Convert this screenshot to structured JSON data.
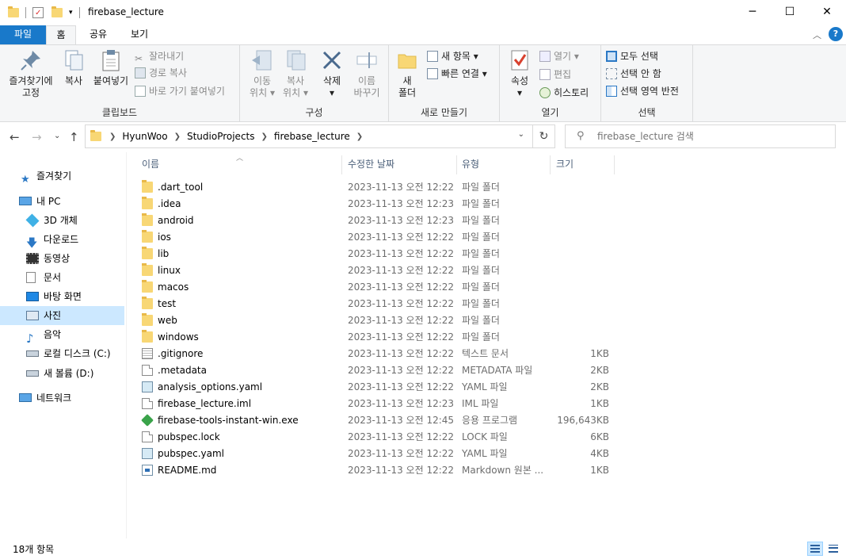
{
  "window": {
    "title": "firebase_lecture",
    "minimize": "─",
    "maximize": "☐",
    "close": "✕"
  },
  "ribbon_tabs": {
    "file": "파일",
    "home": "홈",
    "share": "공유",
    "view": "보기",
    "help": "?"
  },
  "ribbon": {
    "clipboard": {
      "label": "클립보드",
      "pin": "즐겨찾기에\n고정",
      "pin_line1": "즐겨찾기에",
      "pin_line2": "고정",
      "copy": "복사",
      "paste": "붙여넣기",
      "cut": "잘라내기",
      "copy_path": "경로 복사",
      "paste_shortcut": "바로 가기 붙여넣기"
    },
    "organize": {
      "label": "구성",
      "move_to_1": "이동",
      "move_to_2": "위치",
      "copy_to_1": "복사",
      "copy_to_2": "위치",
      "delete": "삭제",
      "rename_1": "이름",
      "rename_2": "바꾸기"
    },
    "new": {
      "label": "새로 만들기",
      "new_folder_1": "새",
      "new_folder_2": "폴더",
      "new_item": "새 항목",
      "easy_access": "빠른 연결"
    },
    "open": {
      "label": "열기",
      "properties": "속성",
      "open": "열기",
      "edit": "편집",
      "history": "히스토리"
    },
    "select": {
      "label": "선택",
      "select_all": "모두 선택",
      "select_none": "선택 안 함",
      "invert": "선택 영역 반전"
    }
  },
  "address": {
    "crumbs": [
      "HyunWoo",
      "StudioProjects",
      "firebase_lecture"
    ],
    "search_placeholder": "firebase_lecture 검색"
  },
  "sidebar": {
    "items": [
      {
        "label": "즐겨찾기",
        "icon": "star-icon"
      },
      {
        "label": "내 PC",
        "icon": "pc-icon"
      },
      {
        "label": "3D 개체",
        "icon": "3d-objects-icon"
      },
      {
        "label": "다운로드",
        "icon": "download-icon"
      },
      {
        "label": "동영상",
        "icon": "video-icon"
      },
      {
        "label": "문서",
        "icon": "document-icon"
      },
      {
        "label": "바탕 화면",
        "icon": "desktop-icon"
      },
      {
        "label": "사진",
        "icon": "pictures-icon"
      },
      {
        "label": "음악",
        "icon": "music-icon"
      },
      {
        "label": "로컬 디스크 (C:)",
        "icon": "drive-c-icon"
      },
      {
        "label": "새 볼륨 (D:)",
        "icon": "drive-d-icon"
      },
      {
        "label": "네트워크",
        "icon": "network-icon"
      }
    ]
  },
  "columns": {
    "name": "이름",
    "date": "수정한 날짜",
    "type": "유형",
    "size": "크기"
  },
  "files": [
    {
      "name": ".dart_tool",
      "date": "2023-11-13 오전 12:22",
      "type": "파일 폴더",
      "size": "",
      "icon": "folder-icon"
    },
    {
      "name": ".idea",
      "date": "2023-11-13 오전 12:23",
      "type": "파일 폴더",
      "size": "",
      "icon": "folder-icon"
    },
    {
      "name": "android",
      "date": "2023-11-13 오전 12:23",
      "type": "파일 폴더",
      "size": "",
      "icon": "folder-icon"
    },
    {
      "name": "ios",
      "date": "2023-11-13 오전 12:22",
      "type": "파일 폴더",
      "size": "",
      "icon": "folder-icon"
    },
    {
      "name": "lib",
      "date": "2023-11-13 오전 12:22",
      "type": "파일 폴더",
      "size": "",
      "icon": "folder-icon"
    },
    {
      "name": "linux",
      "date": "2023-11-13 오전 12:22",
      "type": "파일 폴더",
      "size": "",
      "icon": "folder-icon"
    },
    {
      "name": "macos",
      "date": "2023-11-13 오전 12:22",
      "type": "파일 폴더",
      "size": "",
      "icon": "folder-icon"
    },
    {
      "name": "test",
      "date": "2023-11-13 오전 12:22",
      "type": "파일 폴더",
      "size": "",
      "icon": "folder-icon"
    },
    {
      "name": "web",
      "date": "2023-11-13 오전 12:22",
      "type": "파일 폴더",
      "size": "",
      "icon": "folder-icon"
    },
    {
      "name": "windows",
      "date": "2023-11-13 오전 12:22",
      "type": "파일 폴더",
      "size": "",
      "icon": "folder-icon"
    },
    {
      "name": ".gitignore",
      "date": "2023-11-13 오전 12:22",
      "type": "텍스트 문서",
      "size": "1KB",
      "icon": "text-file-icon"
    },
    {
      "name": ".metadata",
      "date": "2023-11-13 오전 12:22",
      "type": "METADATA 파일",
      "size": "2KB",
      "icon": "file-icon"
    },
    {
      "name": "analysis_options.yaml",
      "date": "2023-11-13 오전 12:22",
      "type": "YAML 파일",
      "size": "2KB",
      "icon": "yaml-file-icon"
    },
    {
      "name": "firebase_lecture.iml",
      "date": "2023-11-13 오전 12:23",
      "type": "IML 파일",
      "size": "1KB",
      "icon": "file-icon"
    },
    {
      "name": "firebase-tools-instant-win.exe",
      "date": "2023-11-13 오전 12:45",
      "type": "응용 프로그램",
      "size": "196,643KB",
      "icon": "exe-icon"
    },
    {
      "name": "pubspec.lock",
      "date": "2023-11-13 오전 12:22",
      "type": "LOCK 파일",
      "size": "6KB",
      "icon": "file-icon"
    },
    {
      "name": "pubspec.yaml",
      "date": "2023-11-13 오전 12:22",
      "type": "YAML 파일",
      "size": "4KB",
      "icon": "yaml-file-icon"
    },
    {
      "name": "README.md",
      "date": "2023-11-13 오전 12:22",
      "type": "Markdown 원본 ...",
      "size": "1KB",
      "icon": "markdown-file-icon"
    }
  ],
  "status": {
    "count": "18개 항목"
  }
}
